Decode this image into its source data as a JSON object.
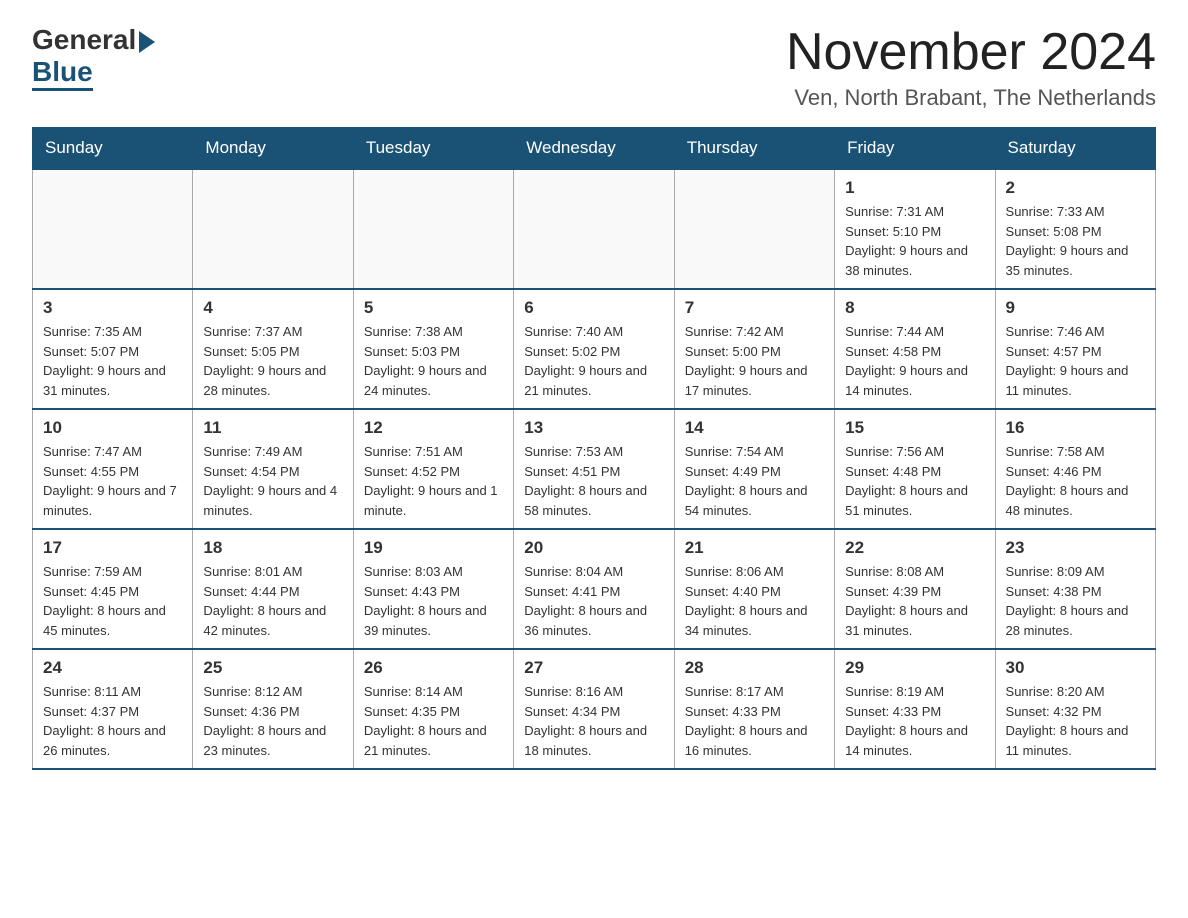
{
  "header": {
    "logo_general": "General",
    "logo_blue": "Blue",
    "month_year": "November 2024",
    "location": "Ven, North Brabant, The Netherlands"
  },
  "calendar": {
    "days_of_week": [
      "Sunday",
      "Monday",
      "Tuesday",
      "Wednesday",
      "Thursday",
      "Friday",
      "Saturday"
    ],
    "weeks": [
      [
        {
          "day": "",
          "detail": ""
        },
        {
          "day": "",
          "detail": ""
        },
        {
          "day": "",
          "detail": ""
        },
        {
          "day": "",
          "detail": ""
        },
        {
          "day": "",
          "detail": ""
        },
        {
          "day": "1",
          "detail": "Sunrise: 7:31 AM\nSunset: 5:10 PM\nDaylight: 9 hours and 38 minutes."
        },
        {
          "day": "2",
          "detail": "Sunrise: 7:33 AM\nSunset: 5:08 PM\nDaylight: 9 hours and 35 minutes."
        }
      ],
      [
        {
          "day": "3",
          "detail": "Sunrise: 7:35 AM\nSunset: 5:07 PM\nDaylight: 9 hours and 31 minutes."
        },
        {
          "day": "4",
          "detail": "Sunrise: 7:37 AM\nSunset: 5:05 PM\nDaylight: 9 hours and 28 minutes."
        },
        {
          "day": "5",
          "detail": "Sunrise: 7:38 AM\nSunset: 5:03 PM\nDaylight: 9 hours and 24 minutes."
        },
        {
          "day": "6",
          "detail": "Sunrise: 7:40 AM\nSunset: 5:02 PM\nDaylight: 9 hours and 21 minutes."
        },
        {
          "day": "7",
          "detail": "Sunrise: 7:42 AM\nSunset: 5:00 PM\nDaylight: 9 hours and 17 minutes."
        },
        {
          "day": "8",
          "detail": "Sunrise: 7:44 AM\nSunset: 4:58 PM\nDaylight: 9 hours and 14 minutes."
        },
        {
          "day": "9",
          "detail": "Sunrise: 7:46 AM\nSunset: 4:57 PM\nDaylight: 9 hours and 11 minutes."
        }
      ],
      [
        {
          "day": "10",
          "detail": "Sunrise: 7:47 AM\nSunset: 4:55 PM\nDaylight: 9 hours and 7 minutes."
        },
        {
          "day": "11",
          "detail": "Sunrise: 7:49 AM\nSunset: 4:54 PM\nDaylight: 9 hours and 4 minutes."
        },
        {
          "day": "12",
          "detail": "Sunrise: 7:51 AM\nSunset: 4:52 PM\nDaylight: 9 hours and 1 minute."
        },
        {
          "day": "13",
          "detail": "Sunrise: 7:53 AM\nSunset: 4:51 PM\nDaylight: 8 hours and 58 minutes."
        },
        {
          "day": "14",
          "detail": "Sunrise: 7:54 AM\nSunset: 4:49 PM\nDaylight: 8 hours and 54 minutes."
        },
        {
          "day": "15",
          "detail": "Sunrise: 7:56 AM\nSunset: 4:48 PM\nDaylight: 8 hours and 51 minutes."
        },
        {
          "day": "16",
          "detail": "Sunrise: 7:58 AM\nSunset: 4:46 PM\nDaylight: 8 hours and 48 minutes."
        }
      ],
      [
        {
          "day": "17",
          "detail": "Sunrise: 7:59 AM\nSunset: 4:45 PM\nDaylight: 8 hours and 45 minutes."
        },
        {
          "day": "18",
          "detail": "Sunrise: 8:01 AM\nSunset: 4:44 PM\nDaylight: 8 hours and 42 minutes."
        },
        {
          "day": "19",
          "detail": "Sunrise: 8:03 AM\nSunset: 4:43 PM\nDaylight: 8 hours and 39 minutes."
        },
        {
          "day": "20",
          "detail": "Sunrise: 8:04 AM\nSunset: 4:41 PM\nDaylight: 8 hours and 36 minutes."
        },
        {
          "day": "21",
          "detail": "Sunrise: 8:06 AM\nSunset: 4:40 PM\nDaylight: 8 hours and 34 minutes."
        },
        {
          "day": "22",
          "detail": "Sunrise: 8:08 AM\nSunset: 4:39 PM\nDaylight: 8 hours and 31 minutes."
        },
        {
          "day": "23",
          "detail": "Sunrise: 8:09 AM\nSunset: 4:38 PM\nDaylight: 8 hours and 28 minutes."
        }
      ],
      [
        {
          "day": "24",
          "detail": "Sunrise: 8:11 AM\nSunset: 4:37 PM\nDaylight: 8 hours and 26 minutes."
        },
        {
          "day": "25",
          "detail": "Sunrise: 8:12 AM\nSunset: 4:36 PM\nDaylight: 8 hours and 23 minutes."
        },
        {
          "day": "26",
          "detail": "Sunrise: 8:14 AM\nSunset: 4:35 PM\nDaylight: 8 hours and 21 minutes."
        },
        {
          "day": "27",
          "detail": "Sunrise: 8:16 AM\nSunset: 4:34 PM\nDaylight: 8 hours and 18 minutes."
        },
        {
          "day": "28",
          "detail": "Sunrise: 8:17 AM\nSunset: 4:33 PM\nDaylight: 8 hours and 16 minutes."
        },
        {
          "day": "29",
          "detail": "Sunrise: 8:19 AM\nSunset: 4:33 PM\nDaylight: 8 hours and 14 minutes."
        },
        {
          "day": "30",
          "detail": "Sunrise: 8:20 AM\nSunset: 4:32 PM\nDaylight: 8 hours and 11 minutes."
        }
      ]
    ]
  }
}
